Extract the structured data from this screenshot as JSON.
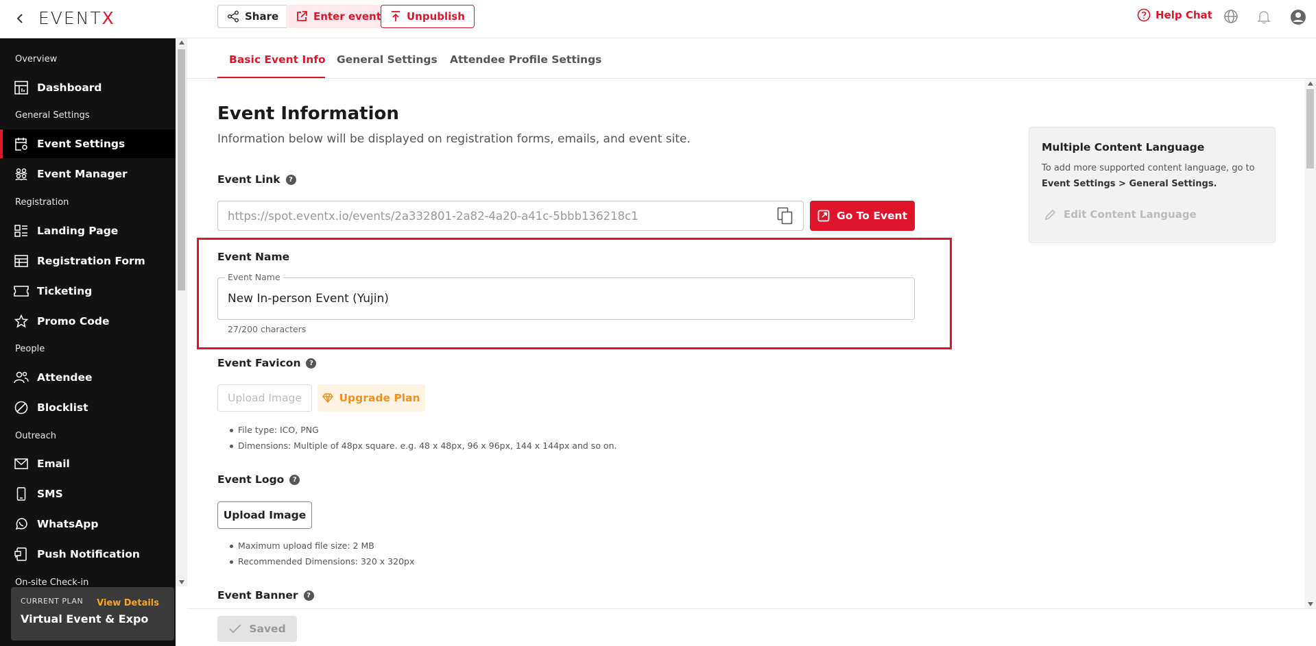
{
  "brand": {
    "logo_prefix": "EVENT",
    "logo_suffix": "X",
    "accent": "#e0142b"
  },
  "topbar": {
    "share_label": "Share",
    "enter_label": "Enter event",
    "unpublish_label": "Unpublish",
    "help_label": "Help Chat"
  },
  "sidebar": {
    "sections": {
      "overview": "Overview",
      "general": "General Settings",
      "registration": "Registration",
      "people": "People",
      "outreach": "Outreach",
      "onsite": "On-site Check-in"
    },
    "items": [
      {
        "label": "Dashboard",
        "icon": "dashboard-icon"
      },
      {
        "label": "Event Settings",
        "icon": "event-settings-icon",
        "active": true
      },
      {
        "label": "Event Manager",
        "icon": "people-group-icon"
      },
      {
        "label": "Landing Page",
        "icon": "landing-page-icon"
      },
      {
        "label": "Registration Form",
        "icon": "table-icon"
      },
      {
        "label": "Ticketing",
        "icon": "ticket-icon"
      },
      {
        "label": "Promo Code",
        "icon": "star-icon"
      },
      {
        "label": "Attendee",
        "icon": "attendee-icon"
      },
      {
        "label": "Blocklist",
        "icon": "block-icon"
      },
      {
        "label": "Email",
        "icon": "mail-icon"
      },
      {
        "label": "SMS",
        "icon": "phone-icon"
      },
      {
        "label": "WhatsApp",
        "icon": "whatsapp-icon"
      },
      {
        "label": "Push Notification",
        "icon": "push-notification-icon"
      }
    ],
    "plan": {
      "label": "CURRENT PLAN",
      "link": "View Details",
      "name": "Virtual Event & Expo"
    }
  },
  "tabs": [
    {
      "label": "Basic Event Info",
      "active": true
    },
    {
      "label": "General Settings"
    },
    {
      "label": "Attendee Profile Settings"
    }
  ],
  "main": {
    "title": "Event Information",
    "subtitle": "Information below will be displayed on registration forms, emails, and event site.",
    "event_link": {
      "label": "Event Link",
      "value": "https://spot.eventx.io/events/2a332801-2a82-4a20-a41c-5bbb136218c1",
      "go_label": "Go To Event"
    },
    "event_name": {
      "label": "Event Name",
      "legend": "Event Name",
      "value": "New In-person Event (Yujin)",
      "count": "27/200 characters"
    },
    "favicon": {
      "label": "Event Favicon",
      "upload_label": "Upload Image",
      "upgrade_label": "Upgrade Plan",
      "notes": [
        "File type: ICO, PNG",
        "Dimensions: Multiple of 48px square. e.g. 48 x 48px, 96 x 96px, 144 x 144px and so on."
      ]
    },
    "logo": {
      "label": "Event Logo",
      "upload_label": "Upload Image",
      "notes": [
        "Maximum upload file size: 2 MB",
        "Recommended Dimensions: 320 x 320px"
      ]
    },
    "banner": {
      "label": "Event Banner"
    }
  },
  "side_card": {
    "title": "Multiple Content Language",
    "desc_prefix": "To add more supported content language, go to",
    "desc_bold": "Event Settings > General Settings.",
    "edit_label": "Edit Content Language"
  },
  "footer": {
    "saved_label": "Saved"
  }
}
